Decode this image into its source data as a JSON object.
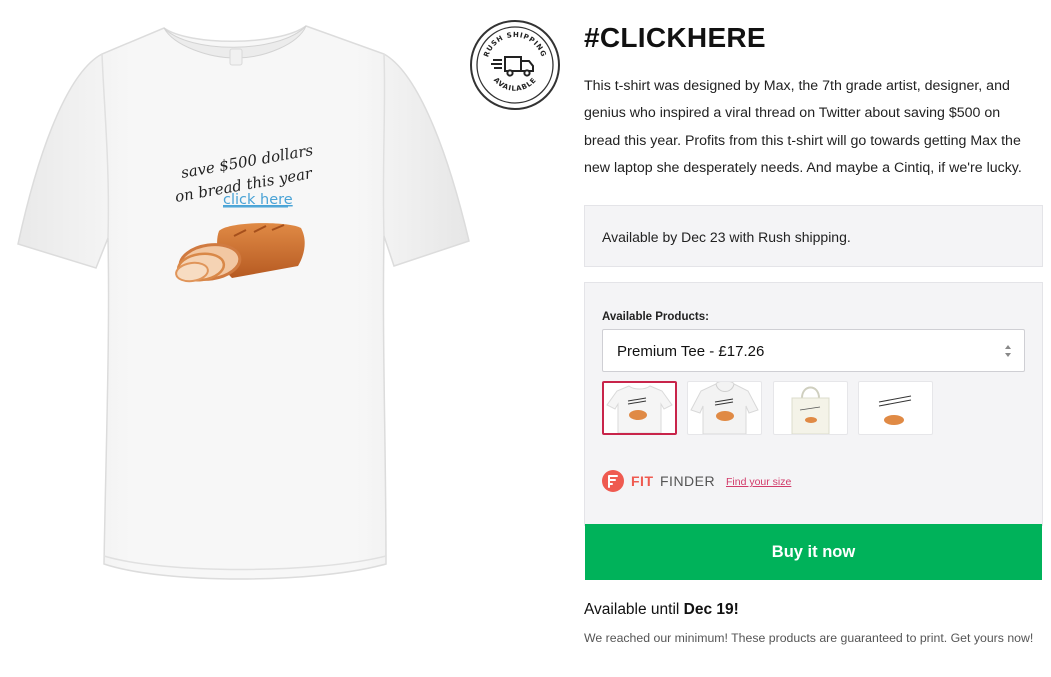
{
  "product": {
    "title": "#CLICKHERE",
    "description": "This t-shirt was designed by Max, the 7th grade artist, designer, and genius who inspired a viral thread on Twitter about saving $500 on bread this year. Profits from this t-shirt will go towards getting Max the new laptop she desperately needs. And maybe a Cintiq, if we're lucky.",
    "shirt_print_line1": "save $500 dollars",
    "shirt_print_line2": "on bread this year",
    "shirt_print_link": "click here"
  },
  "badge": {
    "top_text": "RUSH SHIPPING",
    "bottom_text": "AVAILABLE"
  },
  "shipping": {
    "rush_text": "Available by Dec 23 with Rush shipping."
  },
  "products": {
    "label": "Available Products:",
    "selected": "Premium Tee - £17.26",
    "thumbnails": [
      {
        "name": "premium-tee",
        "active": true
      },
      {
        "name": "hoodie",
        "active": false
      },
      {
        "name": "tote-bag",
        "active": false
      },
      {
        "name": "poster",
        "active": false
      }
    ]
  },
  "fit_finder": {
    "brand_bold": "FIT",
    "brand_light": "FINDER",
    "link": "Find your size"
  },
  "buy": {
    "label": "Buy it now"
  },
  "availability": {
    "prefix": "Available until ",
    "date": "Dec 19!",
    "note": "We reached our minimum! These products are guaranteed to print. Get yours now!"
  },
  "colors": {
    "accent": "#00b25a",
    "active_thumb_border": "#c8244a",
    "fit_red": "#ef5a50",
    "link_pink": "#d23b6a"
  }
}
